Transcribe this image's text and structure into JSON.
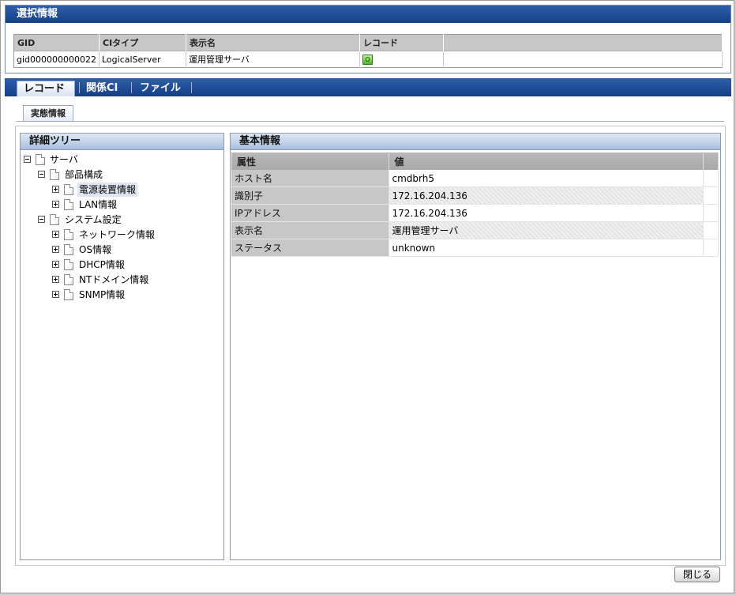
{
  "selected_info": {
    "title": "選択情報",
    "columns": [
      "GID",
      "CIタイプ",
      "表示名",
      "レコード"
    ],
    "row": {
      "gid": "gid000000000022",
      "ci_type": "LogicalServer",
      "display_name": "運用管理サーバ",
      "record_icon": "O"
    }
  },
  "tabs": [
    {
      "label": "レコード",
      "active": true
    },
    {
      "label": "関係CI",
      "active": false
    },
    {
      "label": "ファイル",
      "active": false
    }
  ],
  "subtab": {
    "label": "実態情報"
  },
  "tree_panel": {
    "title": "詳細ツリー",
    "nodes": [
      {
        "label": "サーバ",
        "expanded": true,
        "level": 0
      },
      {
        "label": "部品構成",
        "expanded": true,
        "level": 1
      },
      {
        "label": "電源装置情報",
        "expanded": false,
        "level": 2,
        "selected": true
      },
      {
        "label": "LAN情報",
        "expanded": false,
        "level": 2
      },
      {
        "label": "システム設定",
        "expanded": true,
        "level": 1
      },
      {
        "label": "ネットワーク情報",
        "expanded": false,
        "level": 2
      },
      {
        "label": "OS情報",
        "expanded": false,
        "level": 2
      },
      {
        "label": "DHCP情報",
        "expanded": false,
        "level": 2
      },
      {
        "label": "NTドメイン情報",
        "expanded": false,
        "level": 2
      },
      {
        "label": "SNMP情報",
        "expanded": false,
        "level": 2
      }
    ]
  },
  "basic_info": {
    "title": "基本情報",
    "columns": [
      "属性",
      "値"
    ],
    "rows": [
      {
        "key": "ホスト名",
        "value": "cmdbrh5"
      },
      {
        "key": "識別子",
        "value": "172.16.204.136"
      },
      {
        "key": "IPアドレス",
        "value": "172.16.204.136"
      },
      {
        "key": "表示名",
        "value": "運用管理サーバ"
      },
      {
        "key": "ステータス",
        "value": "unknown"
      }
    ]
  },
  "close_button": {
    "label": "閉じる"
  }
}
